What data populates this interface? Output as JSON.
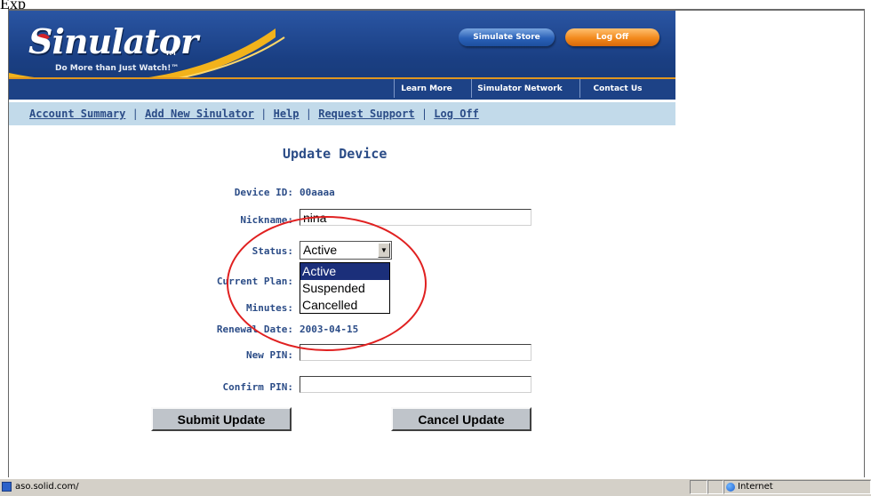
{
  "caption": "Exp",
  "header": {
    "logo": "Sinulator",
    "logo_tm": "TM",
    "tagline": "Do More than Just Watch!™",
    "store_button": "Simulate Store",
    "logoff_button": "Log Off",
    "nav": [
      "Learn More",
      "Simulator Network",
      "Contact Us"
    ]
  },
  "links": {
    "account_summary": "Account Summary",
    "add_new": "Add New Sinulator",
    "help": "Help",
    "request_support": "Request Support",
    "log_off": "Log Off",
    "separator": "|"
  },
  "form": {
    "title": "Update Device",
    "device_id_label": "Device ID:",
    "device_id": "00aaaa",
    "nickname_label": "Nickname:",
    "nickname": "nina",
    "status_label": "Status:",
    "status_value": "Active",
    "status_options": [
      "Active",
      "Suspended",
      "Cancelled"
    ],
    "current_plan_label": "Current Plan:",
    "minutes_label": "Minutes:",
    "renewal_label": "Renewal Date:",
    "renewal_date": "2003-04-15",
    "new_pin_label": "New PIN:",
    "confirm_pin_label": "Confirm PIN:",
    "submit_button": "Submit Update",
    "cancel_button": "Cancel Update"
  },
  "statusbar": {
    "url": "aso.solid.com/",
    "zone": "Internet"
  },
  "colors": {
    "header_blue": "#1c4389",
    "link_blue": "#2b4c87",
    "link_bar": "#c2daea",
    "highlight": "#1b2f7a",
    "annotation": "#e02020"
  }
}
